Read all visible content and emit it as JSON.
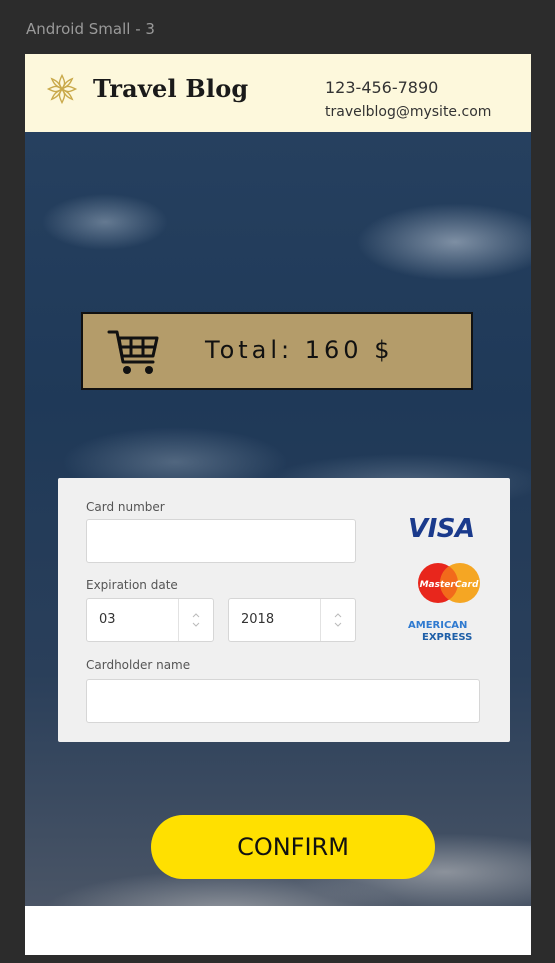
{
  "frame": {
    "label": "Android Small - 3"
  },
  "header": {
    "brand": "Travel Blog",
    "phone": "123-456-7890",
    "email": "travelblog@mysite.com",
    "logo_icon": "flower-icon"
  },
  "cart": {
    "icon": "cart-icon",
    "total_text": "Total: 160 $"
  },
  "payment_form": {
    "card_number_label": "Card number",
    "card_number_value": "",
    "expiration_label": "Expiration date",
    "expiration_month": "03",
    "expiration_year": "2018",
    "cardholder_label": "Cardholder name",
    "cardholder_value": "",
    "brands": {
      "visa": "VISA",
      "mastercard": "MasterCard",
      "amex_line1": "AMERICAN",
      "amex_line2": "EXPRESS"
    }
  },
  "actions": {
    "confirm_label": "CONFIRM"
  },
  "colors": {
    "header_bg": "#fdf8dc",
    "total_bg": "#b49c6a",
    "confirm_bg": "#ffe000",
    "visa_blue": "#1a3a8c"
  }
}
